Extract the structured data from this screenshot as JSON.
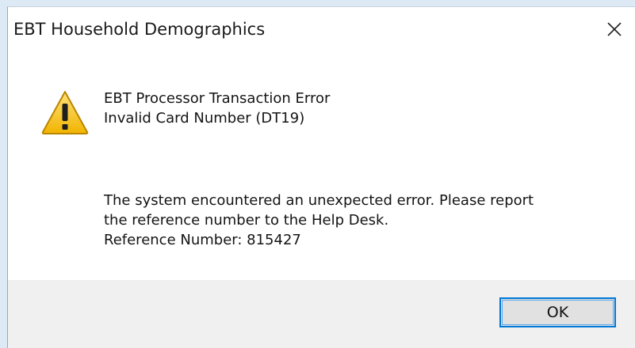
{
  "dialog": {
    "title": "EBT Household Demographics",
    "close_icon": "close-icon",
    "warning_icon": "warning-triangle-icon",
    "error_title": "EBT Processor Transaction Error",
    "error_detail": "Invalid Card Number (DT19)",
    "body_line1": "The system encountered an unexpected error.  Please report",
    "body_line2": "the reference number to the Help Desk.",
    "reference": "Reference Number: 815427",
    "ok_label": "OK"
  },
  "colors": {
    "accent": "#0078d7",
    "footer_bg": "#f0f0f0",
    "warning_fill": "#f6c21c"
  }
}
